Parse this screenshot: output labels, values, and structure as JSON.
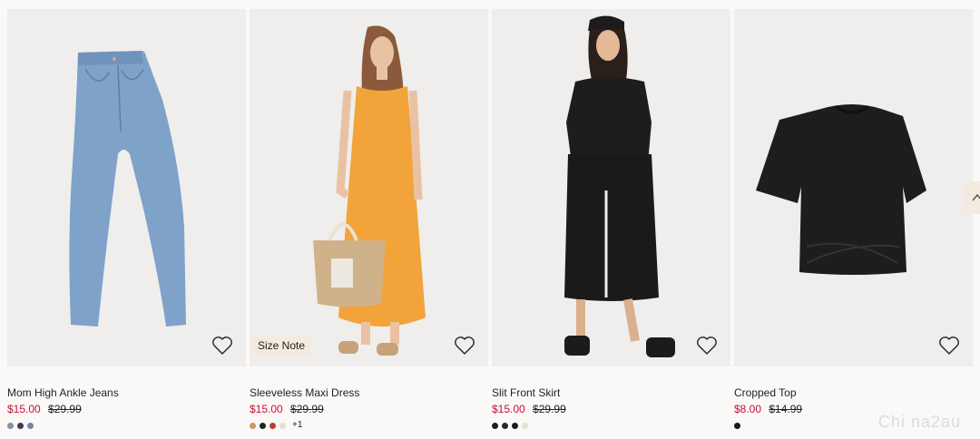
{
  "products": [
    {
      "name": "Mom High Ankle Jeans",
      "price": "$15.00",
      "old_price": "$29.99",
      "swatches": [
        "#7f93ab",
        "#3b3f48",
        "#7288a6"
      ],
      "more": "",
      "badge": ""
    },
    {
      "name": "Sleeveless Maxi Dress",
      "price": "$15.00",
      "old_price": "$29.99",
      "swatches": [
        "#c99a5d",
        "#222222",
        "#c33a2c",
        "#e4e0d6"
      ],
      "more": "+1",
      "badge": "Size Note"
    },
    {
      "name": "Slit Front Skirt",
      "price": "$15.00",
      "old_price": "$29.99",
      "swatches": [
        "#1e1e1e",
        "#2a2a2a",
        "#1a1a1a",
        "#e3e4cf"
      ],
      "more": "",
      "badge": ""
    },
    {
      "name": "Cropped Top",
      "price": "$8.00",
      "old_price": "$14.99",
      "swatches": [
        "#1a1a1a"
      ],
      "more": "",
      "badge": ""
    }
  ],
  "icons": {
    "favorite": "heart-outline-icon",
    "scroll": "chevron-up-icon"
  },
  "colors": {
    "sale": "#c8102e",
    "badge_bg": "#f3ebe0"
  },
  "watermark": "Chi na2au"
}
